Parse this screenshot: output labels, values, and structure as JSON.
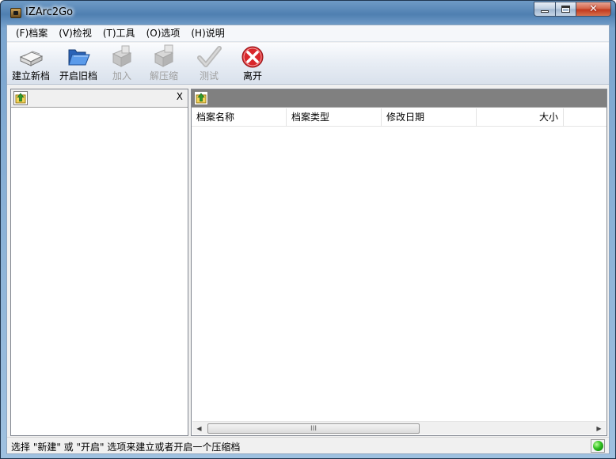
{
  "window": {
    "title": "IZArc2Go"
  },
  "menu": [
    "(F)档案",
    "(V)检视",
    "(T)工具",
    "(O)选项",
    "(H)说明"
  ],
  "toolbar": {
    "new_label": "建立新档",
    "open_label": "开启旧档",
    "add_label": "加入",
    "extract_label": "解压缩",
    "test_label": "测试",
    "exit_label": "离开"
  },
  "left_pane": {
    "close_label": "X"
  },
  "columns": [
    "档案名称",
    "档案类型",
    "修改日期",
    "大小"
  ],
  "scrollbar": {
    "grip": "III"
  },
  "status": {
    "message": "选择 \"新建\" 或 \"开启\" 选项来建立或者开启一个压缩档"
  },
  "colors": {
    "accent": "#4f7fb1",
    "exit": "#d9262b",
    "status_ok": "#2fbf1f"
  }
}
